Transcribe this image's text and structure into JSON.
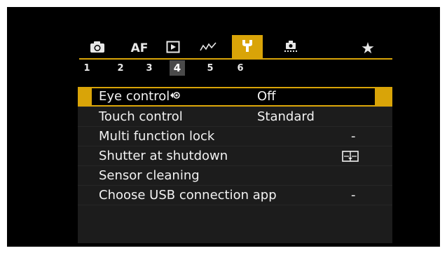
{
  "tabs": [
    {
      "name": "shooting",
      "icon": "camera-icon",
      "label": ""
    },
    {
      "name": "af",
      "icon": "af-icon",
      "label": "AF"
    },
    {
      "name": "playback",
      "icon": "playback-icon",
      "label": ""
    },
    {
      "name": "wireless",
      "icon": "wireless-icon",
      "label": ""
    },
    {
      "name": "setup",
      "icon": "wrench-icon",
      "label": "",
      "active": true
    },
    {
      "name": "custom",
      "icon": "custom-functions-icon",
      "label": ""
    },
    {
      "name": "my-menu",
      "icon": "star-icon",
      "label": "★"
    }
  ],
  "pages": [
    "1",
    "2",
    "3",
    "4",
    "5",
    "6"
  ],
  "active_page": "4",
  "items": [
    {
      "label": "Eye control",
      "value": "Off",
      "selected": true
    },
    {
      "label": "Touch control",
      "value": "Standard"
    },
    {
      "label": "Multi function lock",
      "value": "-"
    },
    {
      "label": "Shutter at shutdown",
      "value": ""
    },
    {
      "label": "Sensor cleaning",
      "value": ""
    },
    {
      "label": "Choose USB connection app",
      "value": "-"
    }
  ],
  "colors": {
    "accent": "#d9a408",
    "background": "#000000",
    "list_background": "#1c1c1c",
    "text": "#f2f2f2"
  }
}
